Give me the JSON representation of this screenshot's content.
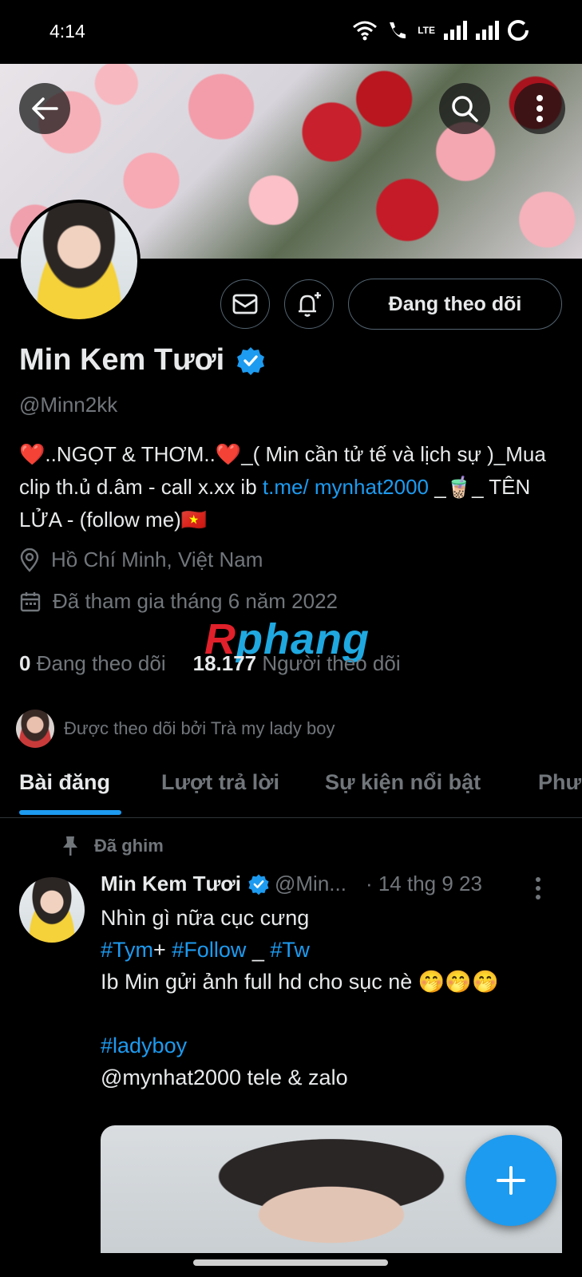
{
  "status_bar": {
    "time": "4:14",
    "network": "LTE"
  },
  "profile": {
    "display_name": "Min Kem Tươi",
    "handle": "@Minn2kk",
    "follow_button": "Đang theo dõi",
    "bio_part1": "❤️..NGỌT & THƠM..❤️_( Min cần tử tế và lịch sự )_Mua clip th.ủ d.âm - call x.xx  ib ",
    "bio_link": "t.me/ mynhat2000",
    "bio_part2": " _🧋_  TÊN LỬA -  (follow me)🇻🇳",
    "location": "Hồ Chí Minh, Việt Nam",
    "joined": "Đã tham gia tháng 6 năm 2022",
    "following_count": "0",
    "following_label": "Đang theo dõi",
    "followers_count": "18.177",
    "followers_label": "Người theo dõi",
    "followed_by": "Được theo dõi bởi Trà my lady boy"
  },
  "tabs": [
    "Bài đăng",
    "Lượt trả lời",
    "Sự kiện nổi bật",
    "Phư"
  ],
  "watermark": {
    "part1": "R",
    "part2": "phang"
  },
  "pinned_tweet": {
    "pinned_label": "Đã ghim",
    "author": "Min Kem Tươi",
    "handle": "@Min...",
    "date": "· 14 thg 9 23",
    "line1": "Nhìn gì nữa cục cưng",
    "tag1": "#Tym",
    "plus": "+ ",
    "tag2": "#Follow",
    "sep": " _ ",
    "tag3": "#Tw",
    "line3": "Ib Min gửi ảnh full hd cho sục nè 🤭🤭🤭",
    "tag4": "#ladyboy",
    "line5": "@mynhat2000 tele & zalo"
  },
  "colors": {
    "accent": "#1d9bf0",
    "background": "#000000",
    "secondary_text": "#71767b"
  }
}
